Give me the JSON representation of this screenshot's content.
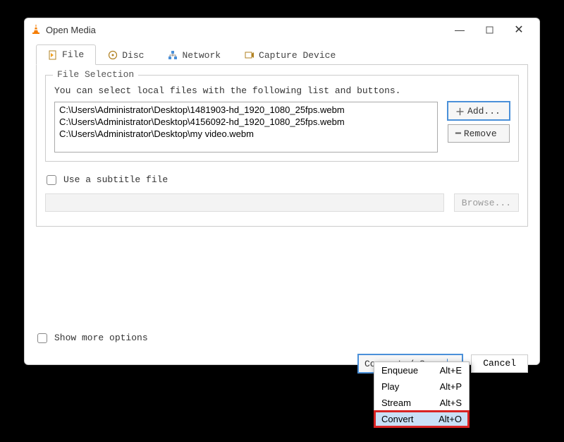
{
  "window": {
    "title": "Open Media"
  },
  "tabs": {
    "file": "File",
    "disc": "Disc",
    "network": "Network",
    "capture": "Capture Device"
  },
  "file_selection": {
    "legend": "File Selection",
    "hint": "You can select local files with the following list and buttons.",
    "items": [
      "C:\\Users\\Administrator\\Desktop\\1481903-hd_1920_1080_25fps.webm",
      "C:\\Users\\Administrator\\Desktop\\4156092-hd_1920_1080_25fps.webm",
      "C:\\Users\\Administrator\\Desktop\\my video.webm"
    ],
    "add": "Add...",
    "remove": "Remove"
  },
  "subtitle": {
    "label": "Use a subtitle file",
    "browse": "Browse..."
  },
  "show_more": "Show more options",
  "actions": {
    "convert_save": "Convert / Save",
    "cancel": "Cancel"
  },
  "dropdown": {
    "items": [
      {
        "label": "Enqueue",
        "shortcut": "Alt+E"
      },
      {
        "label": "Play",
        "shortcut": "Alt+P"
      },
      {
        "label": "Stream",
        "shortcut": "Alt+S"
      },
      {
        "label": "Convert",
        "shortcut": "Alt+O"
      }
    ],
    "highlighted_index": 3
  }
}
